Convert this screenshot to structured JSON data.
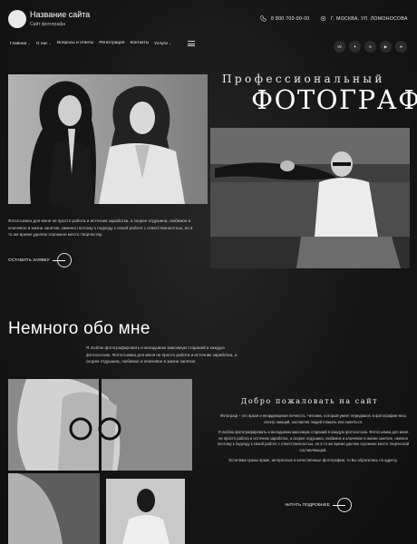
{
  "header": {
    "site_title": "Название сайта",
    "site_subtitle": "Сайт фотографа",
    "phone": "8 800 700-00-00",
    "address": "Г. МОСКВА, УЛ. ЛОМОНОСОВА"
  },
  "nav": {
    "items": [
      "Главная",
      "О нас",
      "Вопросы и ответы",
      "Регистрация",
      "Контакты",
      "Услуги"
    ],
    "dropdown_items": [
      "Главная",
      "О нас",
      "Услуги"
    ]
  },
  "social": [
    "vk-icon",
    "twitter-icon",
    "odnoklassniki-icon",
    "youtube-icon",
    "telegram-icon"
  ],
  "hero": {
    "eyebrow": "Профессиональный",
    "title": "ФОТОГРАФ",
    "text": "Фотосъемка для меня не просто работа и источник заработка, а скорее отдушина, любимое и ключевое в жизни занятие, именно поэтому к подходу к своей работе с ответственностью, но в то же время уделяю огромное место творчеству.",
    "cta": "ОСТАВИТЬ ЗАЯВКУ"
  },
  "about": {
    "title": "Немного обо мне",
    "text": "Я люблю фотографировать и вкладываю максимум стараний в каждую фотосессию. Фотосъемка для меня не просто работа и источник заработка, а скорее отдушина, любимое и ключевое в жизни занятие"
  },
  "welcome": {
    "title": "Добро пожаловать на сайт",
    "p1": "Фотограф – это яркая и неординарная личность. Человек, который умеет передавать в фотографии весь спектр эмоций, заставляя людей плакать или смеяться.",
    "p2": "Я люблю фотографировать и вкладываю максимум стараний в каждую фотосессию. Фотосъемка для меня не просто работа и источник заработка, а скорее отдушина, любимое и ключевое в жизни занятие, именно поэтому к подходу к своей работе с ответственностью, но в то же время уделяю огромное место творческой составляющей.",
    "p3": "Если Вам нужны яркие, интересные и качественные фотографии, то Вы обратились по адресу.",
    "cta": "ЧИТАТЬ ПОДРОБНЕЕ"
  },
  "colors": {
    "background": "#161616",
    "text": "#ffffff",
    "muted": "#cfcfcf"
  }
}
